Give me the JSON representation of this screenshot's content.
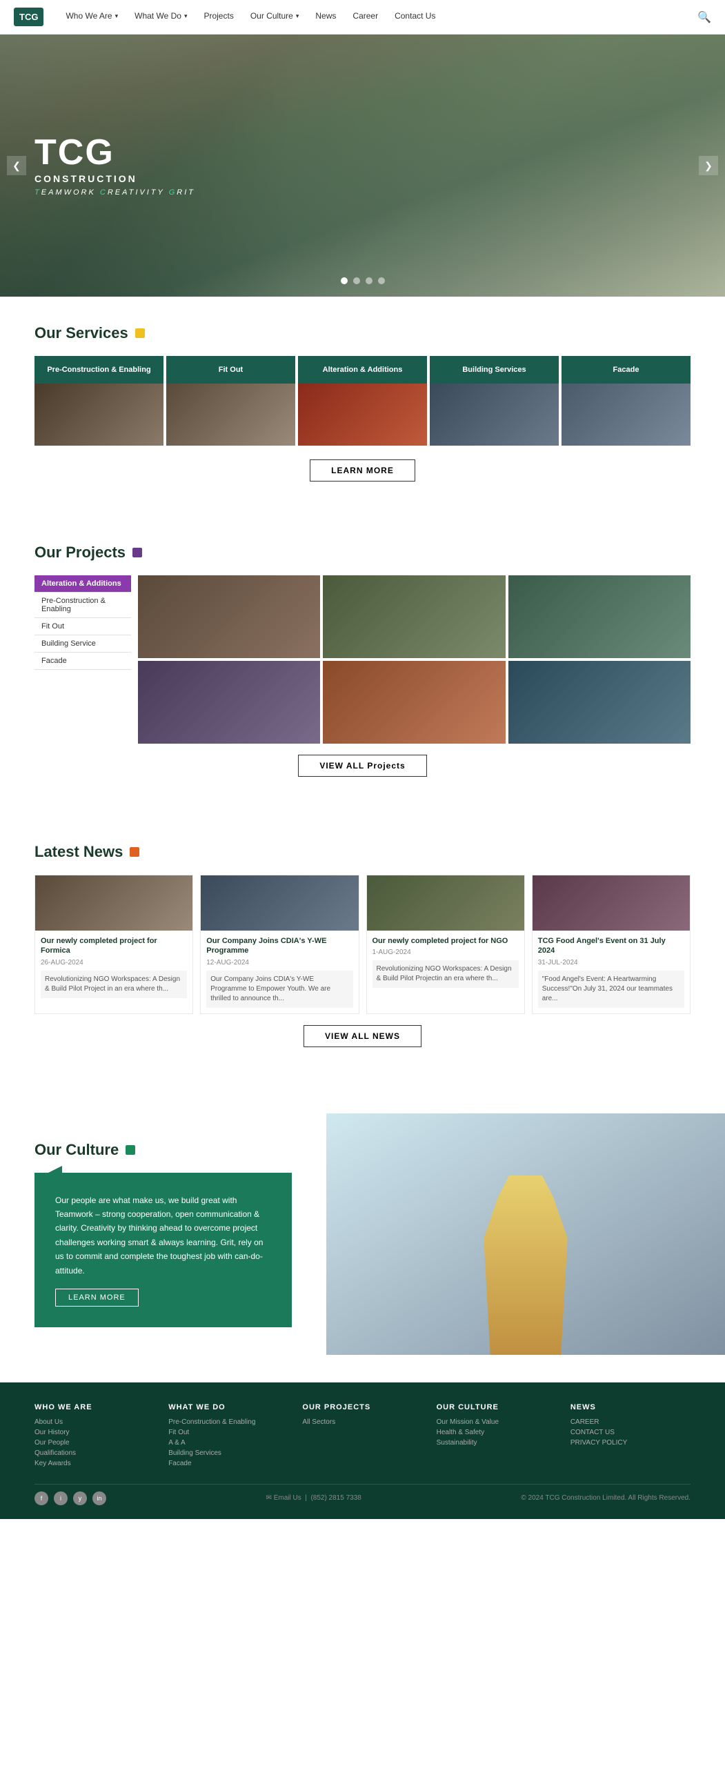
{
  "nav": {
    "logo": "TCG",
    "links": [
      {
        "label": "Who We Are",
        "hasDropdown": true
      },
      {
        "label": "What We Do",
        "hasDropdown": true
      },
      {
        "label": "Projects",
        "hasDropdown": false
      },
      {
        "label": "Our Culture",
        "hasDropdown": true
      },
      {
        "label": "News",
        "hasDropdown": false
      },
      {
        "label": "Career",
        "hasDropdown": false
      },
      {
        "label": "Contact Us",
        "hasDropdown": false
      }
    ]
  },
  "hero": {
    "title": "TCG",
    "subtitle": "CONSTRUCTION",
    "tagline_pre": "T",
    "tagline": "eamwork ",
    "tagline2_pre": "C",
    "tagline2": "reativity ",
    "tagline3_pre": "G",
    "tagline3": "rit",
    "dots": 4,
    "prev_arrow": "❮",
    "next_arrow": "❯"
  },
  "services": {
    "section_title": "Our Services",
    "cards": [
      {
        "label": "Pre-Construction & Enabling"
      },
      {
        "label": "Fit Out"
      },
      {
        "label": "Alteration & Additions"
      },
      {
        "label": "Building Services"
      },
      {
        "label": "Facade"
      }
    ],
    "learn_more": "LEARN MORE"
  },
  "projects": {
    "section_title": "Our Projects",
    "filters": [
      {
        "label": "Alteration & Additions",
        "active": true
      },
      {
        "label": "Pre-Construction & Enabling"
      },
      {
        "label": "Fit Out"
      },
      {
        "label": "Building Service"
      },
      {
        "label": "Facade"
      }
    ],
    "view_all": "VIEW ALL Projects"
  },
  "news": {
    "section_title": "Latest News",
    "cards": [
      {
        "title": "Our newly completed project for Formica",
        "date": "26-AUG-2024",
        "excerpt": "Revolutionizing NGO Workspaces: A Design & Build Pilot Project in an era where th..."
      },
      {
        "title": "Our Company Joins CDIA's Y-WE Programme",
        "date": "12-AUG-2024",
        "excerpt": "Our Company Joins CDIA's Y-WE Programme to Empower Youth. We are thrilled to announce th..."
      },
      {
        "title": "Our newly completed project for NGO",
        "date": "1-AUG-2024",
        "excerpt": "Revolutionizing NGO Workspaces: A Design & Build Pilot Projectin an era where th..."
      },
      {
        "title": "TCG Food Angel's Event on 31 July 2024",
        "date": "31-JUL-2024",
        "excerpt": "\"Food Angel's Event: A Heartwarming Success!\"On July 31, 2024 our teammates are..."
      }
    ],
    "view_all": "VIEW ALL NEWS"
  },
  "culture": {
    "section_title": "Our Culture",
    "body": "Our people are what make us, we build great with Teamwork – strong cooperation, open communication & clarity. Creativity by thinking ahead to overcome project challenges working smart & always learning. Grit, rely on us to commit and complete the toughest job with can-do-attitude.",
    "learn_more": "LEARN MORE"
  },
  "footer": {
    "cols": [
      {
        "title": "WHO WE ARE",
        "links": [
          "About Us",
          "Our History",
          "Our People",
          "Qualifications",
          "Key Awards"
        ]
      },
      {
        "title": "WHAT WE DO",
        "links": [
          "Pre-Construction & Enabling",
          "Fit Out",
          "A & A",
          "Building Services",
          "Facade"
        ]
      },
      {
        "title": "OUR PROJECTS",
        "links": [
          "All Sectors"
        ]
      },
      {
        "title": "OUR CULTURE",
        "links": [
          "Our Mission & Value",
          "Health & Safety",
          "Sustainability"
        ]
      },
      {
        "title": "NEWS",
        "links": [
          "CAREER",
          "CONTACT US",
          "PRIVACY POLICY"
        ]
      }
    ],
    "social": [
      "f",
      "i",
      "y",
      "in"
    ],
    "email_label": "Email Us",
    "phone": "(852) 2815 7338",
    "copyright": "© 2024 TCG Construction Limited. All Rights Reserved."
  }
}
